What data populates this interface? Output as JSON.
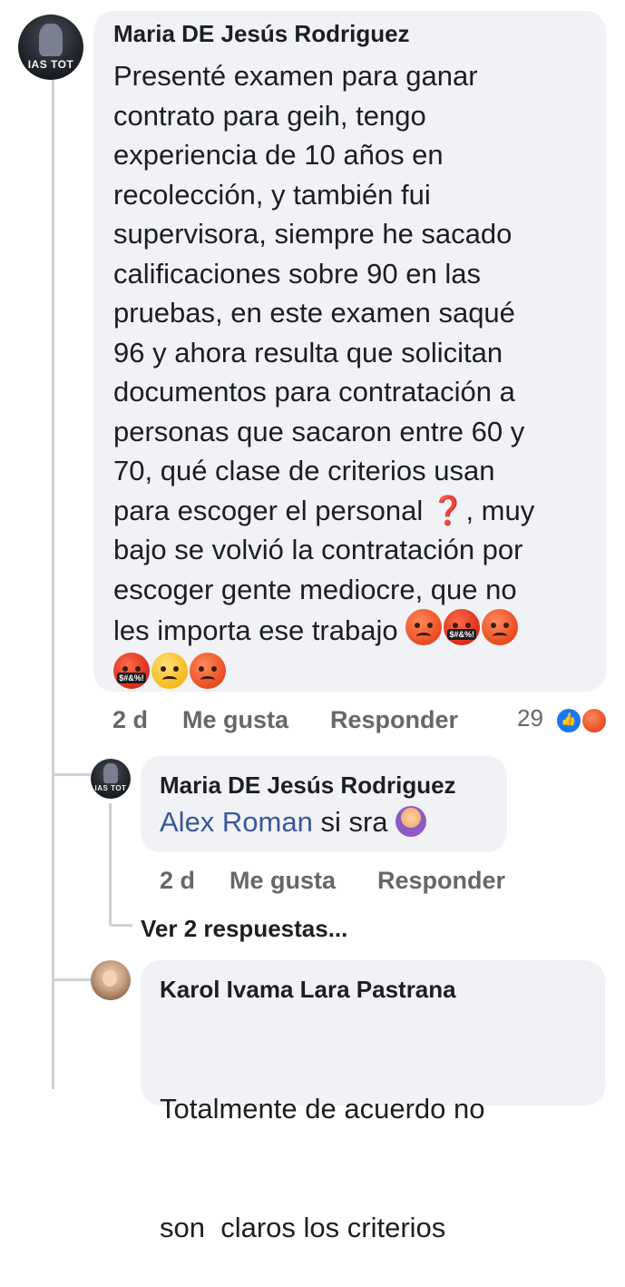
{
  "comment1": {
    "author": "Maria DE Jesús Rodriguez",
    "avatar_text": "IAS TOT",
    "lines": [
      "Presenté examen para ganar",
      "contrato para geih, tengo",
      "experiencia de 10 años en",
      "recolección, y también fui",
      "supervisora, siempre he sacado",
      "calificaciones sobre 90 en las",
      "pruebas, en este examen saqué",
      "96 y ahora resulta que solicitan",
      "documentos para contratación a",
      "personas que sacaron entre 60 y",
      "70, qué clase de criterios usan"
    ],
    "line12_before": "para escoger el personal ",
    "line12_emoji": "❓",
    "line12_after": ", muy",
    "line13": "bajo se volvió la contratación por",
    "line14": "escoger gente mediocre, que no",
    "line15": "les importa ese trabajo ",
    "emoji_cursing_text": "$#&%!",
    "time": "2 d",
    "like_label": "Me gusta",
    "reply_label": "Responder",
    "reaction_count": "29",
    "reaction_icons": [
      "like-icon",
      "angry-icon"
    ]
  },
  "reply1": {
    "author": "Maria DE Jesús Rodriguez",
    "avatar_text": "IAS TOT",
    "mention": "Alex Roman",
    "text": " si sra ",
    "emoji": "facepalm-woman-icon",
    "time": "2 d",
    "like_label": "Me gusta",
    "reply_label": "Responder"
  },
  "view_replies": "Ver 2 respuestas...",
  "comment2": {
    "author": "Karol Ivama Lara Pastrana",
    "lines": [
      "Totalmente de acuerdo no",
      "son  claros los criterios"
    ]
  },
  "colors": {
    "bubble": "#f0f2f5",
    "meta": "#65676b",
    "mention": "#385898",
    "thread_line": "#ced0d4",
    "like_blue": "#1877f2"
  }
}
